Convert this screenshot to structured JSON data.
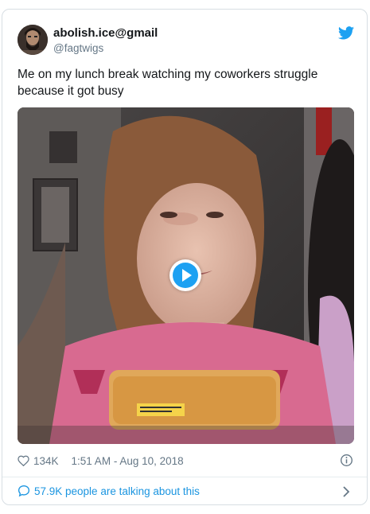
{
  "tweet": {
    "display_name": "abolish.ice@gmail",
    "handle": "@fagtwigs",
    "text": "Me on my lunch break watching my coworkers struggle because it got busy",
    "like_count": "134K",
    "timestamp": "1:51 AM - Aug 10, 2018",
    "conversation_text": "57.9K people are talking about this"
  },
  "colors": {
    "twitter_blue": "#1da1f2",
    "link_blue": "#1b95e0",
    "text_dark": "#14171a",
    "text_gray": "#657786"
  },
  "icons": {
    "brand": "twitter-bird-icon",
    "like": "heart-icon",
    "info": "info-icon",
    "conversation": "speech-bubble-icon",
    "more": "chevron-right-icon",
    "media_overlay": "play-icon"
  }
}
